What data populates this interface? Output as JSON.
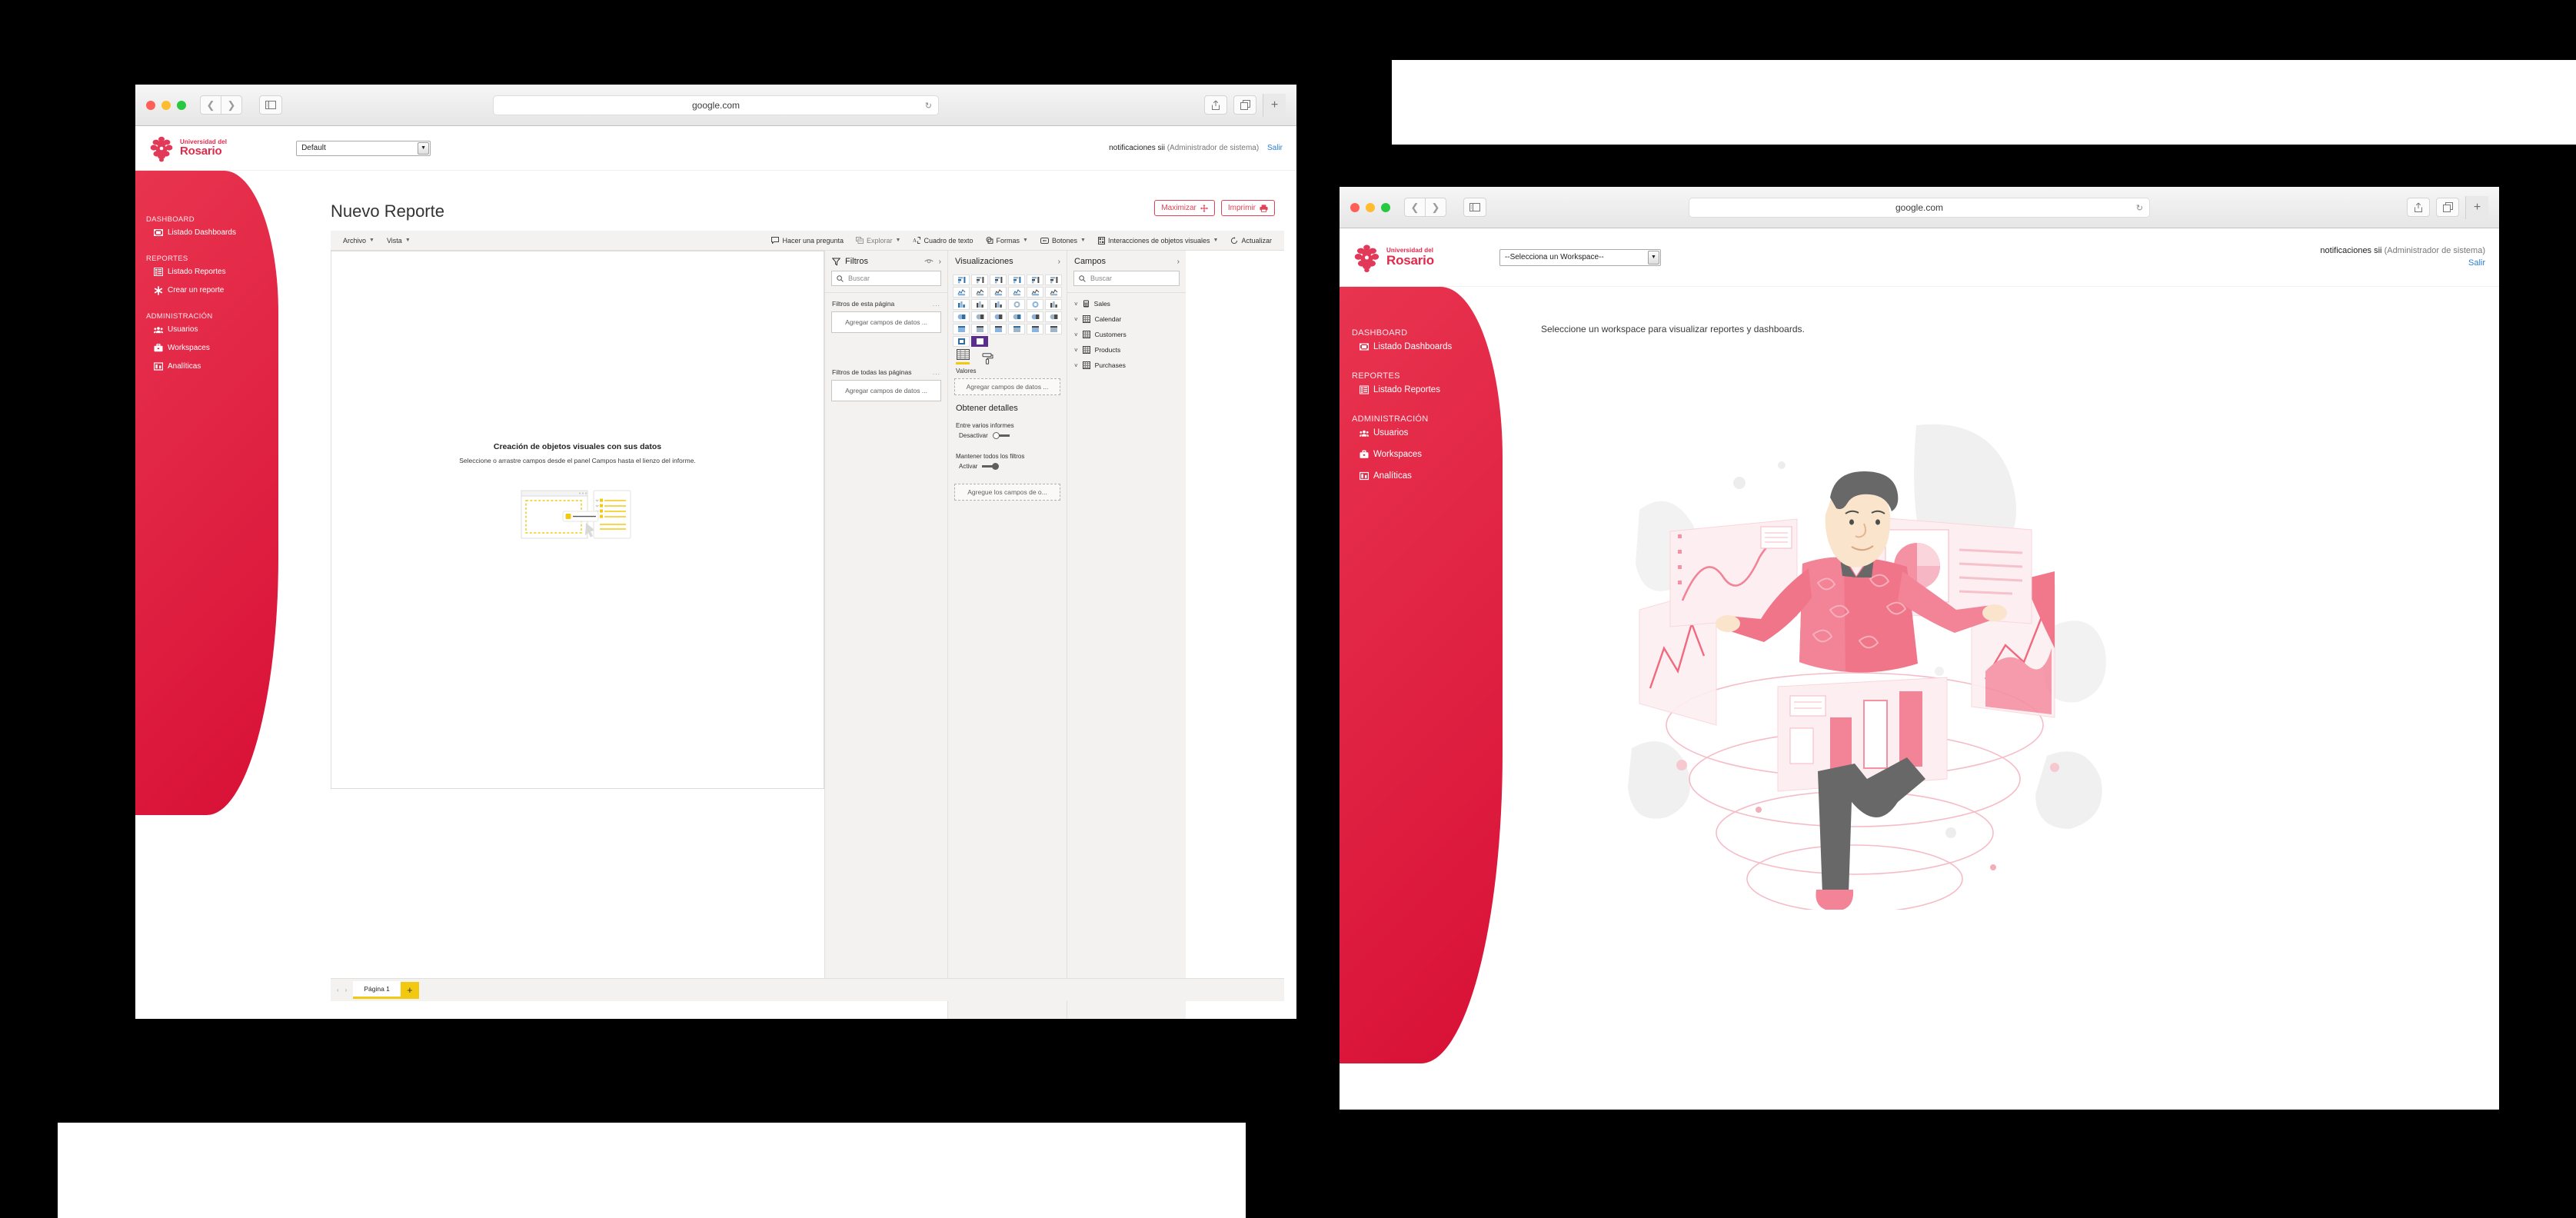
{
  "windows": {
    "report": {
      "browser": {
        "url": "google.com",
        "reload_icon": "reload-icon",
        "share_icon": "share-icon",
        "tabs_icon": "tabs-icon",
        "new_tab": "+"
      },
      "app_header": {
        "brand_line1": "Universidad del",
        "brand_line2": "Rosario",
        "workspace_value": "Default",
        "user_name": "notificaciones sii",
        "user_role": "(Administrador de sistema)",
        "logout": "Salir"
      },
      "sidebar": {
        "groups": [
          {
            "title": "DASHBOARD",
            "items": [
              {
                "label": "Listado Dashboards",
                "icon": "dashboard-icon"
              }
            ]
          },
          {
            "title": "REPORTES",
            "items": [
              {
                "label": "Listado Reportes",
                "icon": "list-icon"
              },
              {
                "label": "Crear un reporte",
                "icon": "asterisk-icon"
              }
            ]
          },
          {
            "title": "ADMINISTRACIÓN",
            "items": [
              {
                "label": "Usuarios",
                "icon": "users-icon"
              },
              {
                "label": "Workspaces",
                "icon": "briefcase-icon"
              },
              {
                "label": "Analíticas",
                "icon": "analytics-icon"
              }
            ]
          }
        ]
      },
      "page_title": "Nuevo Reporte",
      "actions": [
        {
          "label": "Maximizar",
          "icon": "move-arrows-icon"
        },
        {
          "label": "Imprimir",
          "icon": "printer-icon"
        }
      ],
      "ribbon_left": [
        {
          "label": "Archivo",
          "caret": true
        },
        {
          "label": "Vista",
          "caret": true
        }
      ],
      "ribbon_right": [
        {
          "label": "Hacer una pregunta",
          "icon": "chat-bubble-icon",
          "caret": false,
          "dim": false
        },
        {
          "label": "Explorar",
          "icon": "explore-icon",
          "caret": true,
          "dim": true
        },
        {
          "label": "Cuadro de texto",
          "icon": "textbox-icon",
          "caret": false,
          "dim": false
        },
        {
          "label": "Formas",
          "icon": "shapes-icon",
          "caret": true,
          "dim": false
        },
        {
          "label": "Botones",
          "icon": "button-icon",
          "caret": true,
          "dim": false
        },
        {
          "label": "Interacciones de objetos visuales",
          "icon": "interactions-icon",
          "caret": true,
          "dim": false
        },
        {
          "label": "Actualizar",
          "icon": "refresh-icon",
          "caret": false,
          "dim": false
        }
      ],
      "canvas": {
        "empty_title": "Creación de objetos visuales con sus datos",
        "empty_sub": "Seleccione o arrastre campos desde el panel Campos hasta el lienzo del informe."
      },
      "filters_pane": {
        "title": "Filtros",
        "eye_icon": "eye-icon",
        "collapse_icon": "chevron-right-icon",
        "search_placeholder": "Buscar",
        "sections": [
          {
            "label": "Filtros de esta página",
            "dots": "...",
            "drop": "Agregar campos de datos ..."
          },
          {
            "label": "Filtros de todas las páginas",
            "dots": "...",
            "drop": "Agregar campos de datos ..."
          }
        ]
      },
      "viz_pane": {
        "title": "Visualizaciones",
        "collapse_icon": "chevron-right-icon",
        "selected_index": 31,
        "icon_count": 32,
        "tabs": [
          {
            "name": "fields-tab",
            "active": true
          },
          {
            "name": "format-paint-tab",
            "active": false
          }
        ],
        "values_label": "Valores",
        "values_drop": "Agregar campos de datos ...",
        "drill": {
          "title": "Obtener detalles",
          "item1_label": "Entre varios informes",
          "item1_toggle": "Desactivar",
          "item1_state": "off",
          "item2_label": "Mantener todos los filtros",
          "item2_toggle": "Activar",
          "item2_state": "on",
          "drop": "Agregue los campos de o..."
        }
      },
      "fields_pane": {
        "title": "Campos",
        "collapse_icon": "chevron-right-icon",
        "search_placeholder": "Buscar",
        "tables": [
          {
            "name": "Sales",
            "icon": "measure-icon"
          },
          {
            "name": "Calendar",
            "icon": "table-icon"
          },
          {
            "name": "Customers",
            "icon": "table-icon"
          },
          {
            "name": "Products",
            "icon": "table-icon"
          },
          {
            "name": "Purchases",
            "icon": "table-icon"
          }
        ]
      },
      "page_tabs": {
        "prev": "‹",
        "next": "›",
        "tab_label": "Página 1",
        "add_label": "+"
      }
    },
    "workspace": {
      "browser": {
        "url": "google.com",
        "reload_icon": "reload-icon",
        "share_icon": "share-icon",
        "tabs_icon": "tabs-icon",
        "new_tab": "+"
      },
      "app_header": {
        "brand_line1": "Universidad del",
        "brand_line2": "Rosario",
        "workspace_value": "--Selecciona un Workspace--",
        "user_name": "notificaciones sii",
        "user_role": "(Administrador de sistema)",
        "logout": "Salir"
      },
      "sidebar": {
        "groups": [
          {
            "title": "DASHBOARD",
            "items": [
              {
                "label": "Listado Dashboards",
                "icon": "dashboard-icon"
              }
            ]
          },
          {
            "title": "REPORTES",
            "items": [
              {
                "label": "Listado Reportes",
                "icon": "list-icon"
              }
            ]
          },
          {
            "title": "ADMINISTRACIÓN",
            "items": [
              {
                "label": "Usuarios",
                "icon": "users-icon"
              },
              {
                "label": "Workspaces",
                "icon": "briefcase-icon"
              },
              {
                "label": "Analíticas",
                "icon": "analytics-icon"
              }
            ]
          }
        ]
      },
      "message": "Seleccione un workspace para visualizar reportes y dashboards.",
      "illustration": "analyst-with-dashboards-illustration"
    }
  },
  "colors": {
    "brand_red": "#e0294b",
    "sidebar_red_start": "#e8344f",
    "sidebar_red_end": "#d81036",
    "accent_yellow": "#f2c811",
    "link_blue": "#2a7ed8",
    "pane_gray": "#f3f2f1",
    "viz_selected_purple": "#5c2d91"
  }
}
